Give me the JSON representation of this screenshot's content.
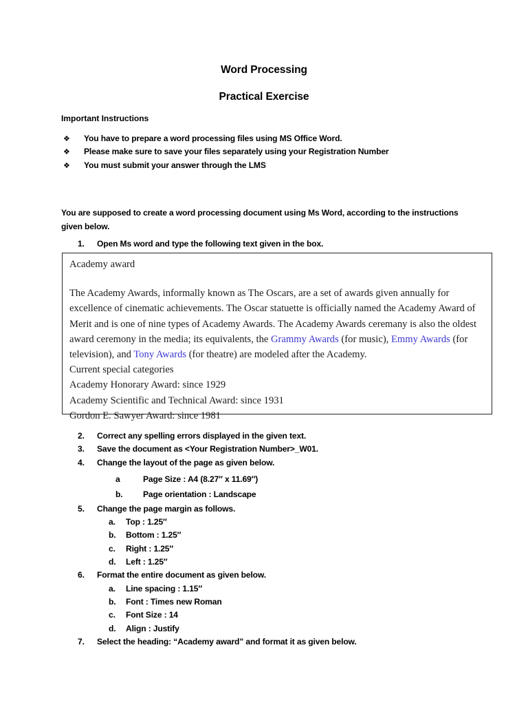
{
  "document": {
    "title_main": "Word Processing",
    "title_sub": "Practical Exercise",
    "instructions_heading": "Important Instructions",
    "bullets": [
      {
        "glyph": "❖",
        "text": "You have to prepare a word processing files using MS Office Word."
      },
      {
        "glyph": "❖",
        "text": " Please make sure to save your files separately using your Registration Number"
      },
      {
        "glyph": "❖",
        "text": "You must submit your answer through the LMS"
      }
    ],
    "lead_paragraph": "You are supposed to create a word processing document using Ms Word, according to the instructions given below.",
    "steps": {
      "s1": {
        "num": "1.",
        "text": "Open Ms word and type the following text given in the box."
      },
      "s2": {
        "num": "2.",
        "text": "Correct any spelling errors displayed in the given text."
      },
      "s3": {
        "num": "3.",
        "text": "Save the document as <Your Registration Number>_W01."
      },
      "s4": {
        "num": "4.",
        "text": "Change the layout of the page as given below."
      },
      "s5": {
        "num": "5.",
        "text": "Change the page margin as follows."
      },
      "s6": {
        "num": "6.",
        "text": "Format the entire document as given below."
      },
      "s7": {
        "num": "7.",
        "text": "Select the heading: “Academy award” and format it as given below."
      }
    },
    "substeps_4": [
      {
        "num": "a",
        "text": "Page Size : A4 (8.27″ x 11.69″)"
      },
      {
        "num": "b.",
        "text": "Page orientation : Landscape"
      }
    ],
    "substeps_5": [
      {
        "num": "a.",
        "text": "Top : 1.25″"
      },
      {
        "num": "b.",
        "text": "Bottom : 1.25″"
      },
      {
        "num": "c.",
        "text": "Right : 1.25″"
      },
      {
        "num": "d.",
        "text": "Left : 1.25″"
      }
    ],
    "substeps_6": [
      {
        "num": "a.",
        "text": "Line spacing : 1.15″"
      },
      {
        "num": "b.",
        "text": "Font : Times new Roman"
      },
      {
        "num": "c.",
        "text": "Font Size : 14"
      },
      {
        "num": "d.",
        "text": "Align : Justify"
      }
    ],
    "quote_box": {
      "heading": "Academy award",
      "body_part_1": "The Academy Awards, informally known as The Oscars, are a set of awards given annually for excellence of cinematic achievements. The Oscar statuette is officially named the  Academy Award of Merit and is one of nine types of Academy Awards. The Academy Awards ceremany is also the oldest award ceremony in the media; its equivalents, the ",
      "link_1": "Grammy Awards",
      "body_part_2": " (for music), ",
      "link_2": "Emmy Awards",
      "body_part_3": " (for television), and ",
      "link_3": "Tony Awards",
      "body_part_4": " (for theatre) are modeled after the Academy.",
      "lines": [
        "Current special categories",
        "Academy Honorary Award: since 1929",
        "Academy Scientific and Technical Award: since 1931",
        "Gordon E. Sawyer Award: since 1981"
      ],
      "link_color": "#3b38cf",
      "border_color": "#262626"
    }
  }
}
